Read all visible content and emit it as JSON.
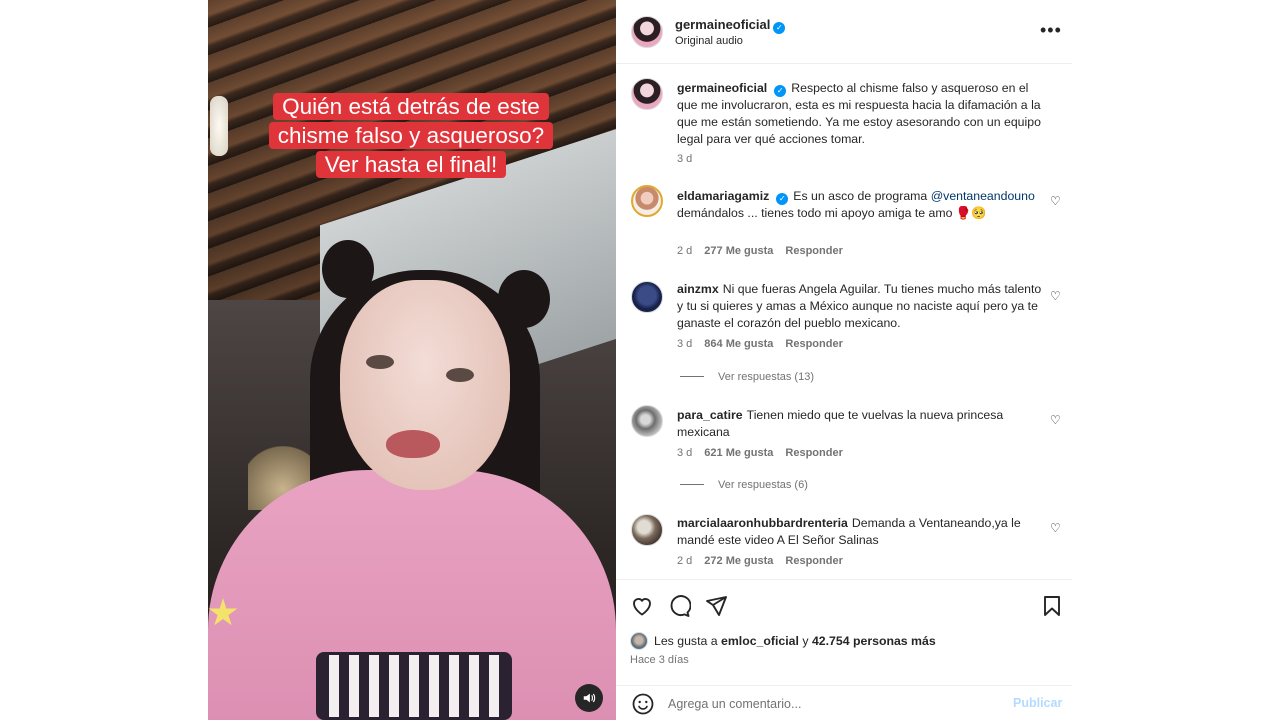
{
  "video": {
    "caption": "Quién está detrás de este chisme falso y asqueroso? Ver hasta el final!",
    "sound_icon": "speaker-icon"
  },
  "header": {
    "username": "germaineoficial",
    "subtitle": "Original audio",
    "more_icon": "more-options-icon"
  },
  "post": {
    "username": "germaineoficial",
    "text": "Respecto al chisme falso y asqueroso en el que me involucraron, esta es mi respuesta hacia la difamación a la que me están sometiendo. Ya me estoy asesorando con un equipo legal para ver qué acciones tomar.",
    "time": "3 d"
  },
  "comments": [
    {
      "username": "eldamariagamiz",
      "verified": true,
      "text_before": "Es un asco de programa",
      "mention": "@ventaneandouno",
      "text_after": "demándalos ... tienes todo mi apoyo amiga te amo 🥊🥺",
      "time": "2 d",
      "likes": "277 Me gusta",
      "reply": "Responder"
    },
    {
      "username": "ainzmx",
      "text": "Ni que fueras Angela Aguilar. Tu tienes mucho más talento y tu si quieres y amas a México aunque no naciste aquí pero ya te ganaste el corazón del pueblo mexicano.",
      "time": "3 d",
      "likes": "864 Me gusta",
      "reply": "Responder",
      "view_replies": "Ver respuestas (13)"
    },
    {
      "username": "para_catire",
      "text": "Tienen miedo que te vuelvas la nueva princesa mexicana",
      "time": "3 d",
      "likes": "621 Me gusta",
      "reply": "Responder",
      "view_replies": "Ver respuestas (6)"
    },
    {
      "username": "marcialaaronhubbardrenteria",
      "text": "Demanda a Ventaneando,ya le mandé este video A El Señor Salinas",
      "time": "2 d",
      "likes": "272 Me gusta",
      "reply": "Responder"
    }
  ],
  "actions": {
    "like_icon": "heart-icon",
    "comment_icon": "comment-icon",
    "share_icon": "share-icon",
    "save_icon": "bookmark-icon",
    "likes_prefix": "Les gusta a",
    "likes_user": "emloc_oficial",
    "likes_middle": "y",
    "likes_count": "42.754 personas más",
    "date": "Hace 3 días"
  },
  "add_comment": {
    "placeholder": "Agrega un comentario...",
    "publish": "Publicar",
    "emoji_icon": "emoji-icon"
  }
}
